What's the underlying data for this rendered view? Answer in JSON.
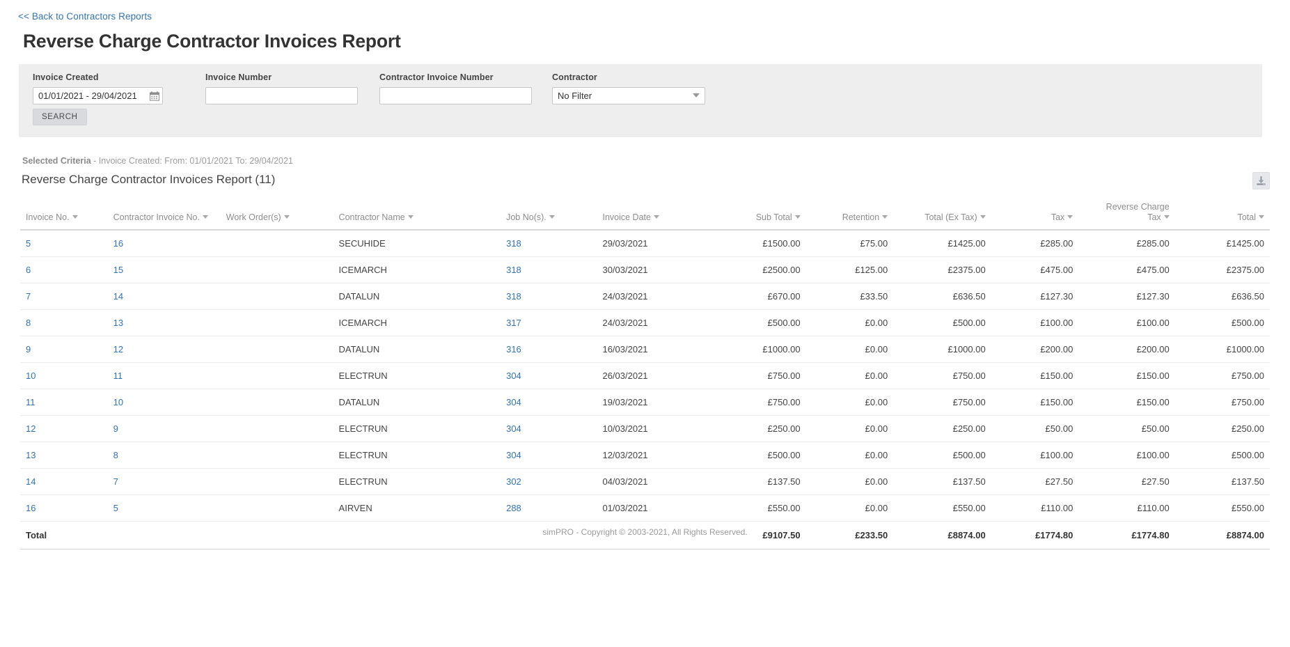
{
  "nav": {
    "back_link": "<< Back to Contractors Reports"
  },
  "page": {
    "title": "Reverse Charge Contractor Invoices Report"
  },
  "filters": {
    "invoice_created": {
      "label": "Invoice Created",
      "value": "01/01/2021 - 29/04/2021",
      "placeholder": "",
      "calendar_icon": "calendar-icon"
    },
    "invoice_number": {
      "label": "Invoice Number",
      "value": "",
      "placeholder": ""
    },
    "contractor_invoice_number": {
      "label": "Contractor Invoice Number",
      "value": "",
      "placeholder": ""
    },
    "contractor": {
      "label": "Contractor",
      "value": "No Filter",
      "options": [
        "No Filter"
      ]
    },
    "search_button": "SEARCH"
  },
  "criteria": {
    "label": "Selected Criteria",
    "text": " - Invoice Created: From: 01/01/2021 To: 29/04/2021"
  },
  "report": {
    "heading": "Reverse Charge Contractor Invoices Report (11)",
    "download_icon": "download-icon",
    "columns": [
      {
        "key": "invoice_no",
        "label": "Invoice No.",
        "align": "l",
        "sortable": true
      },
      {
        "key": "contractor_inv_no",
        "label": "Contractor Invoice No.",
        "align": "l",
        "sortable": true
      },
      {
        "key": "work_orders",
        "label": "Work Order(s)",
        "align": "l",
        "sortable": true
      },
      {
        "key": "contractor_name",
        "label": "Contractor Name",
        "align": "l",
        "sortable": true
      },
      {
        "key": "job_nos",
        "label": "Job No(s).",
        "align": "l",
        "sortable": true
      },
      {
        "key": "invoice_date",
        "label": "Invoice Date",
        "align": "l",
        "sortable": true
      },
      {
        "key": "sub_total",
        "label": "Sub Total",
        "align": "r",
        "sortable": true
      },
      {
        "key": "retention",
        "label": "Retention",
        "align": "r",
        "sortable": true
      },
      {
        "key": "total_ex_tax",
        "label": "Total (Ex Tax)",
        "align": "r",
        "sortable": true
      },
      {
        "key": "tax",
        "label": "Tax",
        "align": "r",
        "sortable": true
      },
      {
        "key": "reverse_charge_tax",
        "label": "Reverse Charge Tax",
        "align": "r",
        "sortable": true,
        "line1": "Reverse Charge",
        "line2": "Tax"
      },
      {
        "key": "total",
        "label": "Total",
        "align": "r",
        "sortable": true
      }
    ],
    "rows": [
      {
        "invoice_no": "5",
        "contractor_inv_no": "16",
        "work_orders": "",
        "contractor_name": "SECUHIDE",
        "job_nos": "318",
        "invoice_date": "29/03/2021",
        "sub_total": "£1500.00",
        "retention": "£75.00",
        "total_ex_tax": "£1425.00",
        "tax": "£285.00",
        "reverse_charge_tax": "£285.00",
        "total": "£1425.00"
      },
      {
        "invoice_no": "6",
        "contractor_inv_no": "15",
        "work_orders": "",
        "contractor_name": "ICEMARCH",
        "job_nos": "318",
        "invoice_date": "30/03/2021",
        "sub_total": "£2500.00",
        "retention": "£125.00",
        "total_ex_tax": "£2375.00",
        "tax": "£475.00",
        "reverse_charge_tax": "£475.00",
        "total": "£2375.00"
      },
      {
        "invoice_no": "7",
        "contractor_inv_no": "14",
        "work_orders": "",
        "contractor_name": "DATALUN",
        "job_nos": "318",
        "invoice_date": "24/03/2021",
        "sub_total": "£670.00",
        "retention": "£33.50",
        "total_ex_tax": "£636.50",
        "tax": "£127.30",
        "reverse_charge_tax": "£127.30",
        "total": "£636.50"
      },
      {
        "invoice_no": "8",
        "contractor_inv_no": "13",
        "work_orders": "",
        "contractor_name": "ICEMARCH",
        "job_nos": "317",
        "invoice_date": "24/03/2021",
        "sub_total": "£500.00",
        "retention": "£0.00",
        "total_ex_tax": "£500.00",
        "tax": "£100.00",
        "reverse_charge_tax": "£100.00",
        "total": "£500.00"
      },
      {
        "invoice_no": "9",
        "contractor_inv_no": "12",
        "work_orders": "",
        "contractor_name": "DATALUN",
        "job_nos": "316",
        "invoice_date": "16/03/2021",
        "sub_total": "£1000.00",
        "retention": "£0.00",
        "total_ex_tax": "£1000.00",
        "tax": "£200.00",
        "reverse_charge_tax": "£200.00",
        "total": "£1000.00"
      },
      {
        "invoice_no": "10",
        "contractor_inv_no": "11",
        "work_orders": "",
        "contractor_name": "ELECTRUN",
        "job_nos": "304",
        "invoice_date": "26/03/2021",
        "sub_total": "£750.00",
        "retention": "£0.00",
        "total_ex_tax": "£750.00",
        "tax": "£150.00",
        "reverse_charge_tax": "£150.00",
        "total": "£750.00"
      },
      {
        "invoice_no": "11",
        "contractor_inv_no": "10",
        "work_orders": "",
        "contractor_name": "DATALUN",
        "job_nos": "304",
        "invoice_date": "19/03/2021",
        "sub_total": "£750.00",
        "retention": "£0.00",
        "total_ex_tax": "£750.00",
        "tax": "£150.00",
        "reverse_charge_tax": "£150.00",
        "total": "£750.00"
      },
      {
        "invoice_no": "12",
        "contractor_inv_no": "9",
        "work_orders": "",
        "contractor_name": "ELECTRUN",
        "job_nos": "304",
        "invoice_date": "10/03/2021",
        "sub_total": "£250.00",
        "retention": "£0.00",
        "total_ex_tax": "£250.00",
        "tax": "£50.00",
        "reverse_charge_tax": "£50.00",
        "total": "£250.00"
      },
      {
        "invoice_no": "13",
        "contractor_inv_no": "8",
        "work_orders": "",
        "contractor_name": "ELECTRUN",
        "job_nos": "304",
        "invoice_date": "12/03/2021",
        "sub_total": "£500.00",
        "retention": "£0.00",
        "total_ex_tax": "£500.00",
        "tax": "£100.00",
        "reverse_charge_tax": "£100.00",
        "total": "£500.00"
      },
      {
        "invoice_no": "14",
        "contractor_inv_no": "7",
        "work_orders": "",
        "contractor_name": "ELECTRUN",
        "job_nos": "302",
        "invoice_date": "04/03/2021",
        "sub_total": "£137.50",
        "retention": "£0.00",
        "total_ex_tax": "£137.50",
        "tax": "£27.50",
        "reverse_charge_tax": "£27.50",
        "total": "£137.50"
      },
      {
        "invoice_no": "16",
        "contractor_inv_no": "5",
        "work_orders": "",
        "contractor_name": "AIRVEN",
        "job_nos": "288",
        "invoice_date": "01/03/2021",
        "sub_total": "£550.00",
        "retention": "£0.00",
        "total_ex_tax": "£550.00",
        "tax": "£110.00",
        "reverse_charge_tax": "£110.00",
        "total": "£550.00"
      }
    ],
    "total_row": {
      "label": "Total",
      "sub_total": "£9107.50",
      "retention": "£233.50",
      "total_ex_tax": "£8874.00",
      "tax": "£1774.80",
      "reverse_charge_tax": "£1774.80",
      "total": "£8874.00"
    }
  },
  "footer": {
    "text": "simPRO - Copyright © 2003-2021, All Rights Reserved."
  },
  "colors": {
    "link": "#3273b5",
    "panel_bg": "#eeeeee",
    "button_bg": "#d9dade",
    "text": "#333333",
    "muted": "#9d9d9d"
  }
}
